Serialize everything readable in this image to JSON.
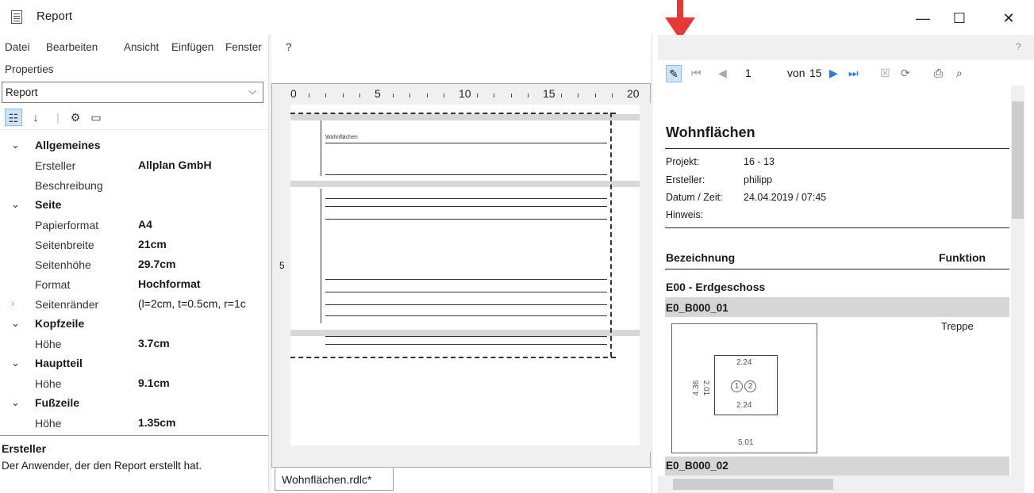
{
  "window": {
    "title": "Report",
    "controls": {
      "minimize": "—",
      "maximize": "☐",
      "close": "✕"
    }
  },
  "menu": [
    "Datei",
    "Bearbeiten",
    "Ansicht",
    "Einfügen",
    "Fenster",
    "?"
  ],
  "properties": {
    "label": "Properties",
    "selected_object": "Report",
    "grid": [
      {
        "kind": "category",
        "name": "Allgemeines"
      },
      {
        "kind": "prop",
        "name": "Ersteller",
        "value": "Allplan GmbH"
      },
      {
        "kind": "prop",
        "name": "Beschreibung",
        "value": ""
      },
      {
        "kind": "category",
        "name": "Seite"
      },
      {
        "kind": "prop",
        "name": "Papierformat",
        "value": "A4"
      },
      {
        "kind": "prop",
        "name": "Seitenbreite",
        "value": "21cm"
      },
      {
        "kind": "prop",
        "name": "Seitenhöhe",
        "value": "29.7cm"
      },
      {
        "kind": "prop",
        "name": "Format",
        "value": "Hochformat"
      },
      {
        "kind": "collapsed",
        "name": "Seitenränder",
        "value": "(l=2cm, t=0.5cm, r=1c"
      },
      {
        "kind": "category",
        "name": "Kopfzeile"
      },
      {
        "kind": "prop",
        "name": "Höhe",
        "value": "3.7cm"
      },
      {
        "kind": "category",
        "name": "Hauptteil"
      },
      {
        "kind": "prop",
        "name": "Höhe",
        "value": "9.1cm"
      },
      {
        "kind": "category",
        "name": "Fußzeile"
      },
      {
        "kind": "prop",
        "name": "Höhe",
        "value": "1.35cm"
      }
    ],
    "description": {
      "title": "Ersteller",
      "text": "Der Anwender, der den Report erstellt hat."
    }
  },
  "designer": {
    "ruler_labels": [
      "0",
      "5",
      "10",
      "15",
      "20"
    ],
    "vertical_ruler_label": "5",
    "tab": "Wohnflächen.rdlc*",
    "heading": "Wohnflächen"
  },
  "preview": {
    "help": "?",
    "page_current": "1",
    "page_of_label": "von",
    "page_total": "15",
    "title": "Wohnflächen",
    "meta": [
      {
        "label": "Projekt:",
        "value": "16 - 13"
      },
      {
        "label": "Ersteller:",
        "value": "philipp"
      },
      {
        "label": "Datum / Zeit:",
        "value": "24.04.2019  /  07:45"
      },
      {
        "label": "Hinweis:",
        "value": ""
      }
    ],
    "columns": {
      "bezeichnung": "Bezeichnung",
      "funktion": "Funktion"
    },
    "group": "E00 - Erdgeschoss",
    "row1": "E0_B000_01",
    "row1_function": "Treppe",
    "row2": "E0_B000_02",
    "plan": {
      "top_dim": "2.24",
      "bottom_dim": "2.24",
      "left_dim_outer": "4.36",
      "left_dim_inner": "2.01",
      "width_dim": "5.01",
      "marker1": "1",
      "marker2": "2"
    }
  },
  "colors": {
    "accent_arrow": "#e53935",
    "toolbar_blue": "#2e7bd6",
    "band_gray": "#d6d6d6"
  }
}
